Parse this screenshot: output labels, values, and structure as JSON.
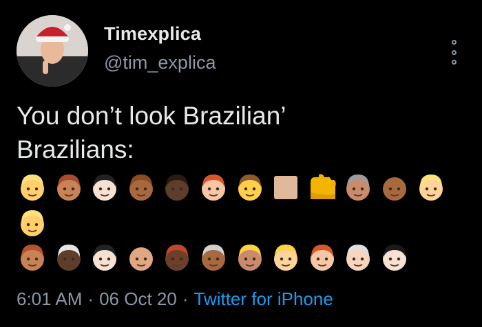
{
  "author": {
    "display_name": "Timexplica",
    "handle": "@tim_explica"
  },
  "tweet": {
    "line1": "You don’t look Brazilian’",
    "line2": "Brazilians:",
    "emoji_row1": [
      {
        "name": "blond-person-emoji",
        "skin": "#ffcf6b",
        "hair": "#ffe07a"
      },
      {
        "name": "red-haired-woman-emoji",
        "skin": "#c98255",
        "hair": "#a84b2e"
      },
      {
        "name": "mustache-man-emoji",
        "skin": "#f6e1d3",
        "hair": "#222222"
      },
      {
        "name": "curly-woman-emoji",
        "skin": "#a8693f",
        "hair": "#8a4b22"
      },
      {
        "name": "dark-skin-man-emoji",
        "skin": "#5f3d2b",
        "hair": "#2a1a10"
      },
      {
        "name": "red-haired-woman-light-emoji",
        "skin": "#f7c6a5",
        "hair": "#d8572a"
      },
      {
        "name": "brown-haired-child-emoji",
        "skin": "#ffcf4b",
        "hair": "#8c5a2b"
      },
      {
        "name": "skin-tone-square-emoji",
        "skin": "#e0b89a",
        "hair": ""
      },
      {
        "name": "yellow-hand-emoji",
        "skin": "#f4b400",
        "hair": ""
      },
      {
        "name": "older-woman-emoji",
        "skin": "#c98b6c",
        "hair": "#9c9c9c"
      },
      {
        "name": "bald-man-emoji",
        "skin": "#a8693f",
        "hair": ""
      },
      {
        "name": "blond-woman-emoji",
        "skin": "#ffd49a",
        "hair": "#ffe07a"
      }
    ],
    "emoji_row2": [
      {
        "name": "blond-person-2-emoji",
        "skin": "#ffcf6b",
        "hair": "#ffe07a"
      }
    ],
    "emoji_row3": [
      {
        "name": "red-bearded-man-emoji",
        "skin": "#c98255",
        "hair": "#b5532b"
      },
      {
        "name": "white-haired-dark-man-emoji",
        "skin": "#5f3d2b",
        "hair": "#e6e6e6"
      },
      {
        "name": "dark-haired-woman-emoji",
        "skin": "#f6e1d3",
        "hair": "#222222"
      },
      {
        "name": "bald-light-man-emoji",
        "skin": "#e0a882",
        "hair": ""
      },
      {
        "name": "red-haired-dark-woman-emoji",
        "skin": "#6b3f2a",
        "hair": "#c2462a"
      },
      {
        "name": "older-man-emoji",
        "skin": "#a8693f",
        "hair": "#d0d0d0"
      },
      {
        "name": "curly-blond-woman-emoji",
        "skin": "#c98b6c",
        "hair": "#ffd23f"
      },
      {
        "name": "curly-blond-light-woman-emoji",
        "skin": "#ffd49a",
        "hair": "#ffd23f"
      },
      {
        "name": "red-haired-man-emoji",
        "skin": "#f7c6a5",
        "hair": "#d8572a"
      },
      {
        "name": "white-haired-woman-emoji",
        "skin": "#f7d5bd",
        "hair": "#e0e0e0"
      },
      {
        "name": "black-haired-woman-emoji",
        "skin": "#f6e1d3",
        "hair": "#1a1a1a"
      }
    ]
  },
  "meta": {
    "time": "6:01 AM",
    "separator": "·",
    "date": "06 Oct 20",
    "source": "Twitter for iPhone"
  },
  "colors": {
    "background": "#000000",
    "text": "#e7e9ea",
    "secondary": "#8b98a5",
    "link": "#1d9bf0"
  }
}
